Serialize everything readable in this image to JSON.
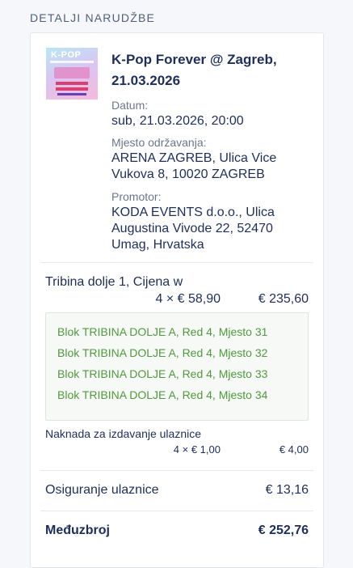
{
  "section": {
    "title": "DETALJI NARUDŽBE"
  },
  "event": {
    "title": "K-Pop Forever @ Zagreb, 21.03.2026",
    "date_label": "Datum:",
    "date_value": "sub, 21.03.2026, 20:00",
    "venue_label": "Mjesto održavanja:",
    "venue_value": "ARENA ZAGREB, Ulica Vice Vukova 8, 10020 ZAGREB",
    "promoter_label": "Promotor:",
    "promoter_value": "KODA EVENTS d.o.o., Ulica Augustina Vivode 22, 52470 Umag, Hrvatska",
    "thumbnail_text": "K-POP"
  },
  "ticket": {
    "title": "Tribina dolje 1, Cijena w",
    "quantity_price": "4 × € 58,90",
    "amount": "€ 235,60",
    "seats": [
      "Blok TRIBINA DOLJE A, Red 4, Mjesto 31",
      "Blok TRIBINA DOLJE A, Red 4, Mjesto 32",
      "Blok TRIBINA DOLJE A, Red 4, Mjesto 33",
      "Blok TRIBINA DOLJE A, Red 4, Mjesto 34"
    ]
  },
  "fee": {
    "title": "Naknada za izdavanje ulaznice",
    "quantity_price": "4 × € 1,00",
    "amount": "€ 4,00"
  },
  "insurance": {
    "label": "Osiguranje ulaznice",
    "amount": "€ 13,16"
  },
  "subtotal": {
    "label": "Međuzbroj",
    "amount": "€ 252,76"
  },
  "colors": {
    "primary_text": "#1d2e5c",
    "seat_text": "#4f9a3d",
    "muted": "#6b7689"
  }
}
